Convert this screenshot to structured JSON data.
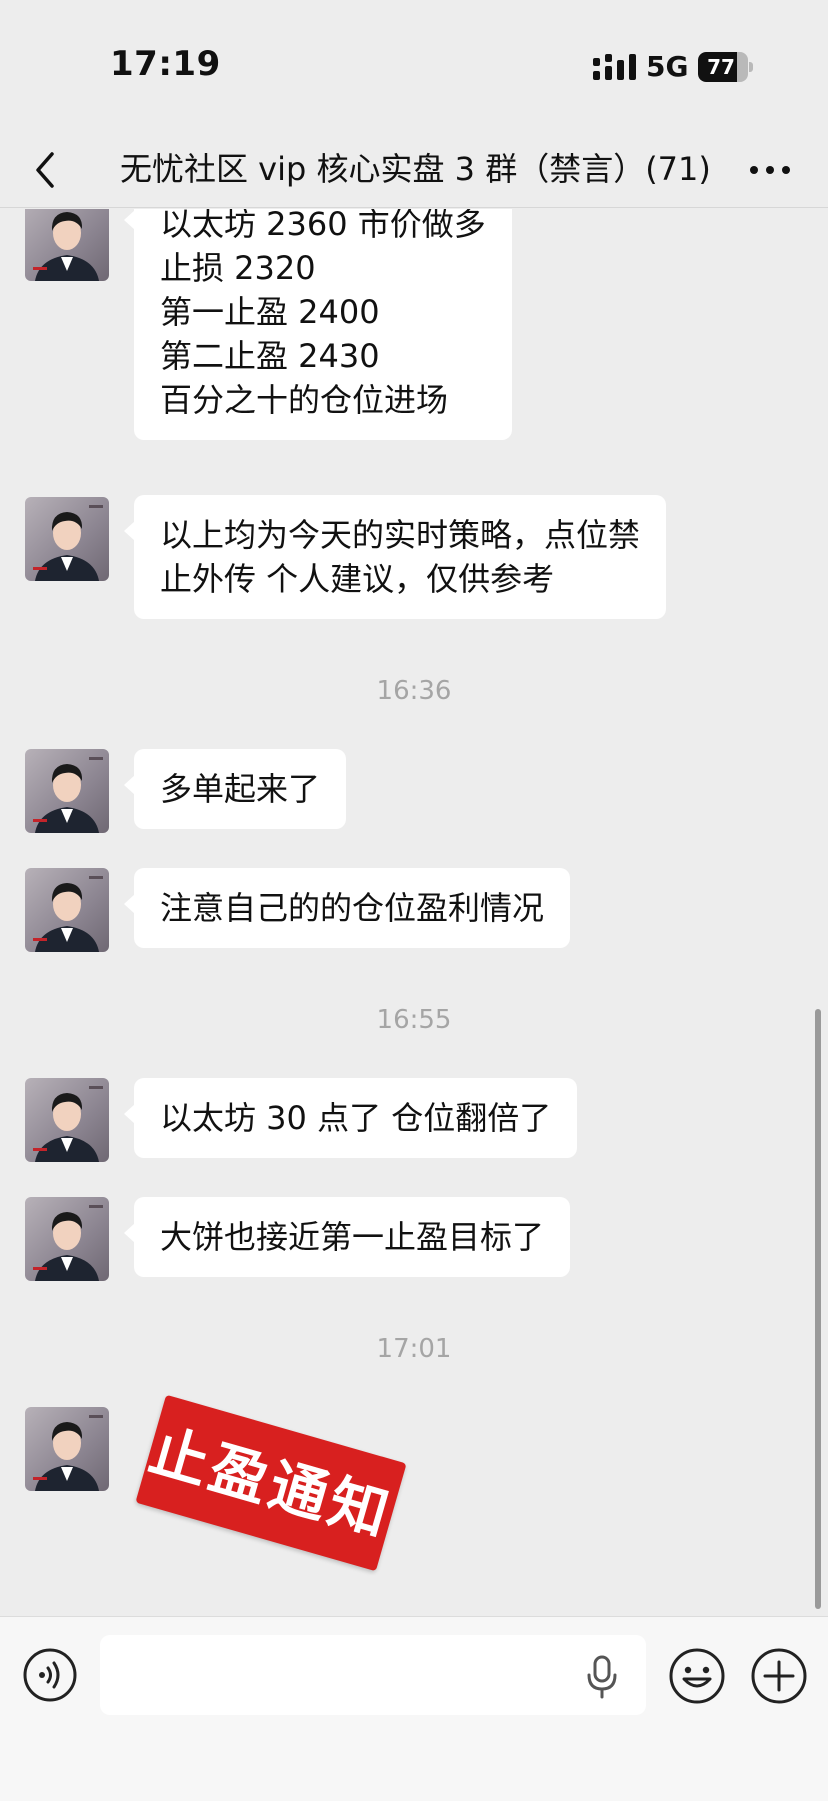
{
  "status_bar": {
    "time": "17:19",
    "network": "5G",
    "battery": "77",
    "battery_fraction": 0.77
  },
  "header": {
    "title": "无忧社区 vip 核心实盘 3 群（禁言）(71)",
    "back_icon": "chevron-left-icon",
    "more_icon": "more-horizontal-icon"
  },
  "messages": [
    {
      "type": "text",
      "text": "以太坊 2360 市价做多\n止损 2320\n第一止盈 2400\n第二止盈 2430\n百分之十的仓位进场"
    },
    {
      "type": "text",
      "text": "以上均为今天的实时策略，点位禁\n止外传 个人建议，仅供参考"
    },
    {
      "type": "time",
      "text": "16:36"
    },
    {
      "type": "text",
      "text": "多单起来了"
    },
    {
      "type": "text",
      "text": "注意自己的的仓位盈利情况"
    },
    {
      "type": "time",
      "text": "16:55"
    },
    {
      "type": "text",
      "text": "以太坊 30 点了 仓位翻倍了"
    },
    {
      "type": "text",
      "text": "大饼也接近第一止盈目标了"
    },
    {
      "type": "time",
      "text": "17:01"
    },
    {
      "type": "sticker",
      "text": "止盈通知"
    }
  ],
  "input_bar": {
    "placeholder": "",
    "voice_icon": "voice-icon",
    "mic_icon": "microphone-icon",
    "emoji_icon": "emoji-icon",
    "plus_icon": "plus-icon"
  },
  "colors": {
    "background": "#ededed",
    "bubble": "#ffffff",
    "stamp_red": "#d8201f",
    "timestamp_gray": "#a5a5a5"
  }
}
